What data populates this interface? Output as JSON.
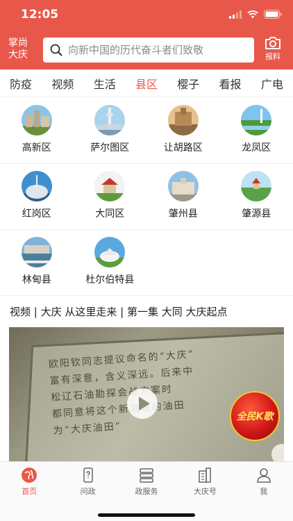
{
  "status": {
    "time": "12:05"
  },
  "header": {
    "brand": "掌尚大庆",
    "search_placeholder": "向新中国的历代奋斗者们致敬",
    "report_label": "报料"
  },
  "tabs": [
    {
      "label": "防疫"
    },
    {
      "label": "视频"
    },
    {
      "label": "生活"
    },
    {
      "label": "县区",
      "active": true
    },
    {
      "label": "樱子"
    },
    {
      "label": "看报"
    },
    {
      "label": "广电"
    }
  ],
  "districts": [
    {
      "name": "高新区",
      "icon": "modern-buildings-photo"
    },
    {
      "name": "萨尔图区",
      "icon": "tower-photo"
    },
    {
      "name": "让胡路区",
      "icon": "monument-photo"
    },
    {
      "name": "龙凤区",
      "icon": "wetland-tower-photo"
    },
    {
      "name": "红岗区",
      "icon": "dome-building-photo"
    },
    {
      "name": "大同区",
      "icon": "pavilion-photo"
    },
    {
      "name": "肇州县",
      "icon": "government-building-photo"
    },
    {
      "name": "肇源县",
      "icon": "lake-pagoda-photo"
    },
    {
      "name": "林甸县",
      "icon": "hot-spring-photo"
    },
    {
      "name": "杜尔伯特县",
      "icon": "yurt-photo"
    }
  ],
  "article": {
    "title": "视频 | 大庆 从这里走来 | 第一集 大同 大庆起点"
  },
  "video": {
    "inscription": [
      "欧阳钦同志提议命名的“大庆”",
      "富有深意，含义深远。后来中",
      "松辽石油勘探会战方案时",
      "都同意将这个新发现的油田",
      "为“大庆油田”"
    ],
    "ad_badge": "全民K歌"
  },
  "bottom_nav": [
    {
      "label": "首页",
      "icon": "globe-home-icon",
      "active": true
    },
    {
      "label": "问政",
      "icon": "phone-question-icon"
    },
    {
      "label": "政服务",
      "icon": "server-stack-icon"
    },
    {
      "label": "大庆号",
      "icon": "building-icon"
    },
    {
      "label": "我",
      "icon": "person-icon"
    }
  ],
  "colors": {
    "brand": "#e8584a",
    "active": "#e8584a"
  }
}
